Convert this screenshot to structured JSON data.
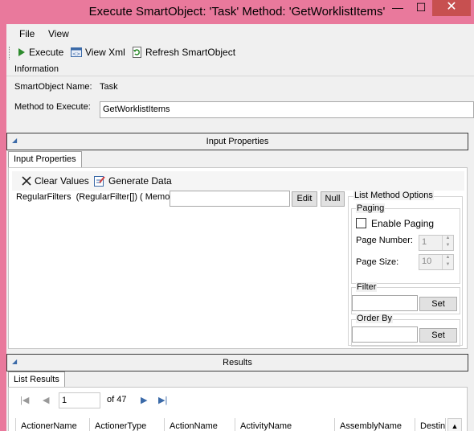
{
  "window": {
    "title": "Execute SmartObject: 'Task' Method: 'GetWorklistItems'",
    "minimize_symbol": "—",
    "maximize_symbol": "☐",
    "close_symbol": "✕"
  },
  "menu": [
    "File",
    "View"
  ],
  "toolbar": {
    "execute": "Execute",
    "view_xml": "View Xml",
    "refresh": "Refresh SmartObject"
  },
  "information": {
    "group_label": "Information",
    "smartobject_name_label": "SmartObject Name:",
    "smartobject_name_value": "Task",
    "method_label": "Method to Execute:",
    "method_value": "GetWorklistItems"
  },
  "input_section": {
    "header": "Input Properties",
    "tab_label": "Input Properties",
    "clear_values": "Clear Values",
    "generate_data": "Generate Data",
    "param_label": "RegularFilters  (RegularFilter[]) ( Memo )",
    "param_value": "",
    "edit_label": "Edit",
    "null_label": "Null"
  },
  "list_method_options": {
    "title": "List Method Options",
    "paging_title": "Paging",
    "enable_paging_label": "Enable Paging",
    "enable_paging_checked": false,
    "page_number_label": "Page Number:",
    "page_number_value": "1",
    "page_size_label": "Page Size:",
    "page_size_value": "10",
    "filter_title": "Filter",
    "filter_value": "",
    "filter_set": "Set",
    "order_by_title": "Order By",
    "order_by_value": "",
    "order_by_set": "Set"
  },
  "results": {
    "header": "Results",
    "tab_label": "List Results",
    "page_value": "1",
    "page_of": "of 47",
    "columns": [
      "ActionerName",
      "ActionerType",
      "ActionName",
      "ActivityName",
      "AssemblyName",
      "Destina"
    ]
  },
  "colors": {
    "titlebar": "#e9799c",
    "close_button": "#c75050",
    "accent_blue": "#3b6aa8",
    "execute_green": "#2e8b2e"
  }
}
